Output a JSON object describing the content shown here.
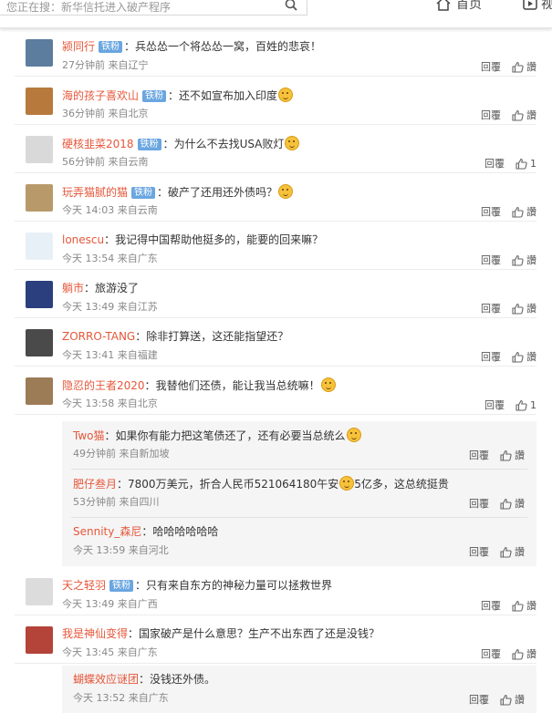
{
  "header": {
    "search_placeholder": "您正在搜：新华信托进入破产程序",
    "home_label": "首页",
    "video_label": "视频"
  },
  "ui": {
    "reply_label": "回覆",
    "badge_label": "铁粉",
    "like_zero_label": "讚"
  },
  "comments": [
    {
      "user": "颍同行",
      "badge": true,
      "text": "兵怂怂一个将怂怂一窝，百姓的悲哀！",
      "emoji": false,
      "time": "27分钟前",
      "location": "来自辽宁",
      "likes": "讚"
    },
    {
      "user": "海的孩子喜欢山",
      "badge": true,
      "text": "还不如宣布加入印度",
      "emoji": true,
      "time": "36分钟前",
      "location": "来自北京",
      "likes": "讚"
    },
    {
      "user": "硬核韭菜2018",
      "badge": true,
      "text": "为什么不去找USA败灯",
      "emoji": true,
      "time": "56分钟前",
      "location": "来自云南",
      "likes": "1"
    },
    {
      "user": "玩弄猫腻的猫",
      "badge": true,
      "text": "破产了还用还外债吗？",
      "emoji": true,
      "time": "今天 14:03",
      "location": "来自云南",
      "likes": "讚"
    },
    {
      "user": "lonescu",
      "badge": false,
      "text": "我记得中国帮助他挺多的，能要的回来嘛？",
      "emoji": false,
      "time": "今天 13:54",
      "location": "来自广东",
      "likes": "讚"
    },
    {
      "user": "躺市",
      "badge": false,
      "text": "旅游没了",
      "emoji": false,
      "time": "今天 13:49",
      "location": "来自江苏",
      "likes": "讚"
    },
    {
      "user": "ZORRO-TANG",
      "badge": false,
      "text": "除非打算送，这还能指望还？",
      "emoji": false,
      "time": "今天 13:41",
      "location": "来自福建",
      "likes": "讚"
    },
    {
      "user": "隐忍的王者2020",
      "badge": false,
      "text": "我替他们还债，能让我当总统嘛！",
      "emoji": true,
      "time": "今天 13:58",
      "location": "来自北京",
      "likes": "1"
    }
  ],
  "replies": [
    {
      "user": "Two猫",
      "text": "如果你有能力把这笔债还了，还有必要当总统么",
      "emoji": true,
      "time": "49分钟前",
      "location": "来自新加坡",
      "likes": "讚"
    },
    {
      "user": "肥仔叁月",
      "text": "7800万美元，折合人民币521064180午安",
      "text2": "5亿多，这总统挺贵",
      "emoji": true,
      "time": "53分钟前",
      "location": "来自四川",
      "likes": "讚"
    },
    {
      "user": "Sennity_森尼",
      "text": "哈哈哈哈哈哈",
      "emoji": false,
      "time": "今天 13:59",
      "location": "来自河北",
      "likes": "讚"
    }
  ],
  "comments2": [
    {
      "user": "天之轻羽",
      "badge": true,
      "text": "只有来自东方的神秘力量可以拯救世界",
      "emoji": false,
      "time": "今天 13:49",
      "location": "来自广西",
      "likes": "讚"
    },
    {
      "user": "我是神仙变得",
      "badge": false,
      "text": "国家破产是什么意思？生产不出东西了还是没钱？",
      "emoji": false,
      "time": "今天 13:45",
      "location": "来自广东",
      "likes": "讚"
    }
  ],
  "replies2": [
    {
      "user": "蝴蝶效应谜团",
      "text": "没钱还外债。",
      "emoji": false,
      "time": "今天 13:52",
      "location": "来自广东",
      "likes": "讚"
    }
  ],
  "colors": {
    "username": "#e5573a",
    "badge": "#6aa6e0",
    "meta": "#888888",
    "nested_bg": "#f5f5f5"
  }
}
